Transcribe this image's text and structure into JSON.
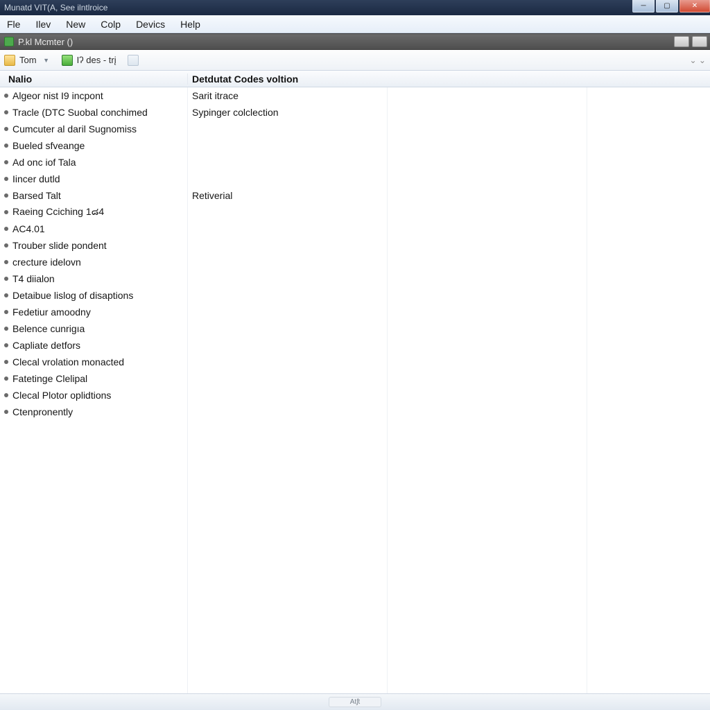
{
  "title": "Munatd VIT(A, See ilntlroice",
  "menu": {
    "file": "Fle",
    "ilev": "Ilev",
    "new": "New",
    "colp": "Colp",
    "devics": "Devics",
    "help": "Help"
  },
  "darkbar": {
    "label": "P.kl Mcmter ()"
  },
  "toolbar": {
    "tom": "Tom",
    "des": "Iʔ des - trį"
  },
  "columns": {
    "name": "Nalio",
    "code": "Detdutat Codes voltion"
  },
  "rows": [
    {
      "name": "Algeor nist I9 incpont",
      "code": "Sarit itrace"
    },
    {
      "name": "Tracle (DTC Suobal conchimed",
      "code": "Sypinger colclection"
    },
    {
      "name": "Cumcuter al daril Sugnomiss",
      "code": ""
    },
    {
      "name": "Bueled sfveange",
      "code": ""
    },
    {
      "name": "Ad onc iof Tala",
      "code": ""
    },
    {
      "name": "Iincer dutld",
      "code": ""
    },
    {
      "name": "Barsed Talt",
      "code": "Retiverial"
    },
    {
      "name": "Raeing Cciching 1๘4",
      "code": ""
    },
    {
      "name": "AC4.01",
      "code": ""
    },
    {
      "name": "Trouber slide pondent",
      "code": ""
    },
    {
      "name": "crecture idelovn",
      "code": ""
    },
    {
      "name": "T4 diialon",
      "code": ""
    },
    {
      "name": "Detaibue lislog of disaptions",
      "code": ""
    },
    {
      "name": "Fedetiur amoodny",
      "code": ""
    },
    {
      "name": "Belence cunrigıa",
      "code": ""
    },
    {
      "name": "Capliate detfors",
      "code": ""
    },
    {
      "name": "Clecal vrolation monacted",
      "code": ""
    },
    {
      "name": "Fatetinge Clelipal",
      "code": ""
    },
    {
      "name": "Clecal Plotor oplidtions",
      "code": ""
    },
    {
      "name": "Ctenpronently",
      "code": ""
    }
  ],
  "status": "Atʃt"
}
